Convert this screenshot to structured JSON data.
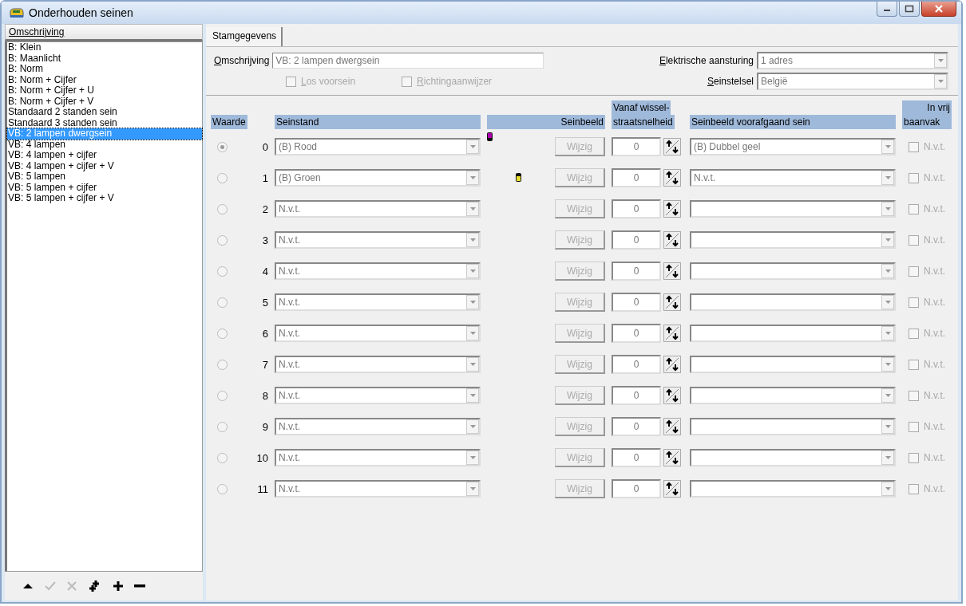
{
  "window": {
    "title": "Onderhouden seinen"
  },
  "list": {
    "header": "Omschrijving",
    "items": [
      {
        "label": "B: Klein",
        "selected": false
      },
      {
        "label": "B: Maanlicht",
        "selected": false
      },
      {
        "label": "B: Norm",
        "selected": false
      },
      {
        "label": "B: Norm + Cijfer",
        "selected": false
      },
      {
        "label": "B: Norm + Cijfer + U",
        "selected": false
      },
      {
        "label": "B: Norm + Cijfer + V",
        "selected": false
      },
      {
        "label": "Standaard 2 standen sein",
        "selected": false
      },
      {
        "label": "Standaard 3 standen sein",
        "selected": false
      },
      {
        "label": "VB: 2 lampen dwergsein",
        "selected": true
      },
      {
        "label": "VB: 4 lampen",
        "selected": false
      },
      {
        "label": "VB: 4 lampen + cijfer",
        "selected": false
      },
      {
        "label": "VB: 4 lampen + cijfer + V",
        "selected": false
      },
      {
        "label": "VB: 5 lampen",
        "selected": false
      },
      {
        "label": "VB: 5 lampen + cijfer",
        "selected": false
      },
      {
        "label": "VB: 5 lampen + cijfer + V",
        "selected": false
      }
    ],
    "toolbar": [
      {
        "kind": "up",
        "disabled": false
      },
      {
        "kind": "check",
        "disabled": true
      },
      {
        "kind": "cross",
        "disabled": true
      },
      {
        "kind": "copy",
        "disabled": false
      },
      {
        "kind": "add",
        "disabled": false
      },
      {
        "kind": "remove",
        "disabled": false
      }
    ]
  },
  "tabs": [
    {
      "label": "Stamgegevens",
      "selected": true
    }
  ],
  "form": {
    "description": {
      "label": "Omschrijving",
      "value": "VB: 2 lampen dwergsein"
    },
    "checkboxes": [
      {
        "label": "Los voorsein",
        "checked": false
      },
      {
        "label": "Richtingaanwijzer",
        "checked": false
      }
    ],
    "control": {
      "label": "Elektrische aansturing",
      "value": "1 adres"
    },
    "system": {
      "label": "Seinstelsel",
      "value": "België"
    }
  },
  "columns": {
    "value": "Waarde",
    "state": "Seinstand",
    "aspect": "Seinbeeld",
    "speed_top": "Vanaf wissel-",
    "speed": "straatsnelheid",
    "previous": "Seinbeeld voorafgaand sein",
    "free_top": "In vrij",
    "free": "baanvak"
  },
  "rows": [
    {
      "selected": true,
      "value": "0",
      "state": "(B) Rood",
      "lamp": {
        "color": "#b000b0",
        "kind": "upper"
      },
      "button": "Wijzig",
      "speed": "0",
      "previous": "(B) Dubbel geel",
      "free": {
        "label": "N.v.t.",
        "checked": false
      }
    },
    {
      "selected": false,
      "value": "1",
      "state": "(B) Groen",
      "lamp": {
        "color": "#e8e030",
        "kind": "lower"
      },
      "button": "Wijzig",
      "speed": "0",
      "previous": "N.v.t.",
      "free": {
        "label": "N.v.t.",
        "checked": false
      }
    },
    {
      "selected": false,
      "value": "2",
      "state": "N.v.t.",
      "button": "Wijzig",
      "speed": "0",
      "free": {
        "label": "N.v.t.",
        "checked": false
      }
    },
    {
      "selected": false,
      "value": "3",
      "state": "N.v.t.",
      "button": "Wijzig",
      "speed": "0",
      "free": {
        "label": "N.v.t.",
        "checked": false
      }
    },
    {
      "selected": false,
      "value": "4",
      "state": "N.v.t.",
      "button": "Wijzig",
      "speed": "0",
      "free": {
        "label": "N.v.t.",
        "checked": false
      }
    },
    {
      "selected": false,
      "value": "5",
      "state": "N.v.t.",
      "button": "Wijzig",
      "speed": "0",
      "free": {
        "label": "N.v.t.",
        "checked": false
      }
    },
    {
      "selected": false,
      "value": "6",
      "state": "N.v.t.",
      "button": "Wijzig",
      "speed": "0",
      "free": {
        "label": "N.v.t.",
        "checked": false
      }
    },
    {
      "selected": false,
      "value": "7",
      "state": "N.v.t.",
      "button": "Wijzig",
      "speed": "0",
      "free": {
        "label": "N.v.t.",
        "checked": false
      }
    },
    {
      "selected": false,
      "value": "8",
      "state": "N.v.t.",
      "button": "Wijzig",
      "speed": "0",
      "free": {
        "label": "N.v.t.",
        "checked": false
      }
    },
    {
      "selected": false,
      "value": "9",
      "state": "N.v.t.",
      "button": "Wijzig",
      "speed": "0",
      "free": {
        "label": "N.v.t.",
        "checked": false
      }
    },
    {
      "selected": false,
      "value": "10",
      "state": "N.v.t.",
      "button": "Wijzig",
      "speed": "0",
      "free": {
        "label": "N.v.t.",
        "checked": false
      }
    },
    {
      "selected": false,
      "value": "11",
      "state": "N.v.t.",
      "button": "Wijzig",
      "speed": "0",
      "free": {
        "label": "N.v.t.",
        "checked": false
      }
    }
  ]
}
